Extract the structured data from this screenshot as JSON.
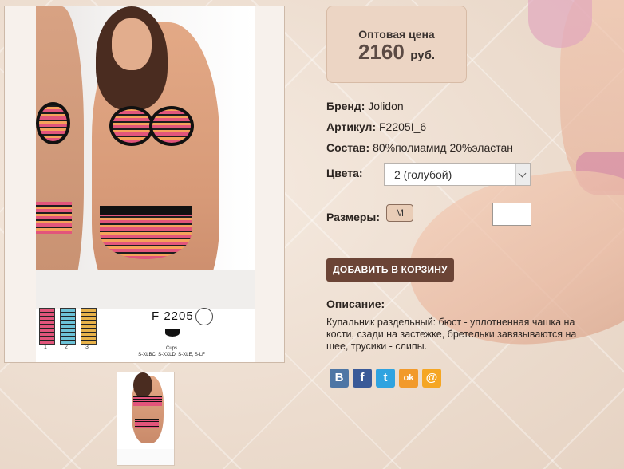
{
  "product": {
    "code_on_image": "F 2205",
    "cups_label": "Cups\nS-XLBC, S-XXLD, S-XLE, S-LF",
    "swatch_numbers": [
      "1",
      "2",
      "3"
    ]
  },
  "price": {
    "label": "Оптовая цена",
    "value": "2160",
    "currency": "руб."
  },
  "properties": {
    "brand_label": "Бренд:",
    "brand_value": "Jolidon",
    "sku_label": "Артикул:",
    "sku_value": "F2205I_6",
    "composition_label": "Состав:",
    "composition_value": "80%полиамид 20%эластан"
  },
  "colors": {
    "label": "Цвета:",
    "selected": "2 (голубой)"
  },
  "sizes": {
    "label": "Размеры:",
    "options": [
      "M"
    ],
    "quantity": ""
  },
  "cart": {
    "button_label": "ДОБАВИТЬ В КОРЗИНУ"
  },
  "description": {
    "title": "Описание:",
    "text": "Купальник раздельный: бюст - уплотненная  чашка на кости, сзади на застежке, бретельки завязываются на шее, трусики - слипы."
  },
  "share": {
    "icons": [
      "vkontakte-icon",
      "facebook-icon",
      "twitter-icon",
      "odnoklassniki-icon",
      "mailru-icon"
    ],
    "glyphs": [
      "B",
      "f",
      "t",
      "ok",
      "@"
    ]
  },
  "colors_theme": {
    "price_bg": "#ecd5c4",
    "cart_btn": "#6b4436",
    "size_btn": "#e9cdb7"
  }
}
